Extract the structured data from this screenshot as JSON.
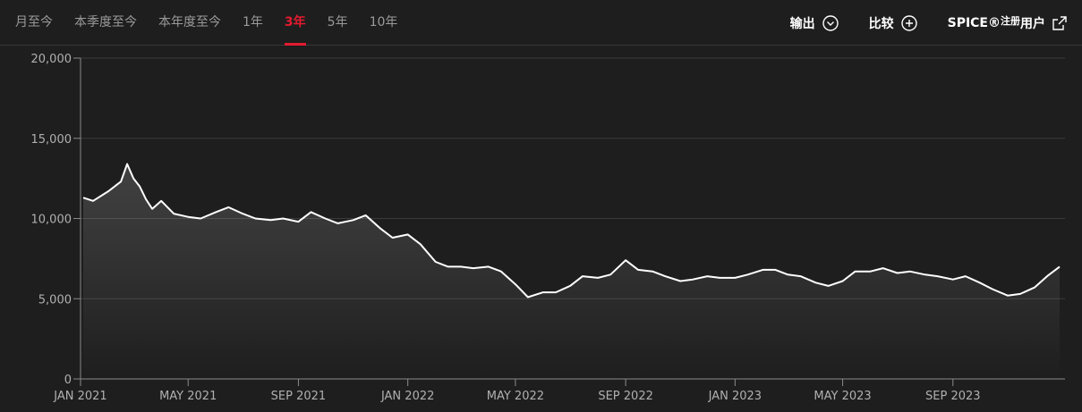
{
  "tabs": [
    {
      "label": "月至今",
      "active": false
    },
    {
      "label": "本季度至今",
      "active": false
    },
    {
      "label": "本年度至今",
      "active": false
    },
    {
      "label": "1年",
      "active": false
    },
    {
      "label": "3年",
      "active": true
    },
    {
      "label": "5年",
      "active": false
    },
    {
      "label": "10年",
      "active": false
    }
  ],
  "actions": {
    "export_label": "输出",
    "compare_label": "比较",
    "spice_label": "SPICE®",
    "spice_sup": "注册",
    "spice_suffix": "用户"
  },
  "colors": {
    "background": "#1e1e1e",
    "accent": "#e31b2f",
    "line": "#ffffff",
    "text_muted": "#9a9a9a"
  },
  "chart_data": {
    "type": "line",
    "title": "",
    "xlabel": "",
    "ylabel": "",
    "ylim": [
      0,
      20000
    ],
    "y_ticks": [
      "0",
      "5,000",
      "10,000",
      "15,000",
      "20,000"
    ],
    "x_ticks": [
      "JAN 2021",
      "MAY 2021",
      "SEP 2021",
      "JAN 2022",
      "MAY 2022",
      "SEP 2022",
      "JAN 2023",
      "MAY 2023",
      "SEP 2023"
    ],
    "grid": "horizontal",
    "series": [
      {
        "x": [
          "2021-01-04",
          "2021-01-15",
          "2021-02-01",
          "2021-02-15",
          "2021-02-22",
          "2021-03-01",
          "2021-03-08",
          "2021-03-15",
          "2021-03-22",
          "2021-04-01",
          "2021-04-15",
          "2021-05-01",
          "2021-05-15",
          "2021-06-01",
          "2021-06-15",
          "2021-07-01",
          "2021-07-15",
          "2021-08-01",
          "2021-08-15",
          "2021-09-01",
          "2021-09-15",
          "2021-10-01",
          "2021-10-15",
          "2021-11-01",
          "2021-11-15",
          "2021-12-01",
          "2021-12-15",
          "2022-01-01",
          "2022-01-15",
          "2022-02-01",
          "2022-02-15",
          "2022-03-01",
          "2022-03-15",
          "2022-04-01",
          "2022-04-15",
          "2022-05-01",
          "2022-05-15",
          "2022-06-01",
          "2022-06-15",
          "2022-07-01",
          "2022-07-15",
          "2022-08-01",
          "2022-08-15",
          "2022-09-01",
          "2022-09-15",
          "2022-10-01",
          "2022-10-15",
          "2022-11-01",
          "2022-11-15",
          "2022-12-01",
          "2022-12-15",
          "2023-01-01",
          "2023-01-15",
          "2023-02-01",
          "2023-02-15",
          "2023-03-01",
          "2023-03-15",
          "2023-04-01",
          "2023-04-15",
          "2023-05-01",
          "2023-05-15",
          "2023-06-01",
          "2023-06-15",
          "2023-07-01",
          "2023-07-15",
          "2023-08-01",
          "2023-08-15",
          "2023-09-01",
          "2023-09-15",
          "2023-10-01",
          "2023-10-15",
          "2023-11-01",
          "2023-11-15",
          "2023-12-01",
          "2023-12-15",
          "2023-12-29"
        ],
        "values": [
          11300,
          11100,
          11700,
          12300,
          13400,
          12500,
          12000,
          11200,
          10600,
          11100,
          10300,
          10100,
          10000,
          10400,
          10700,
          10300,
          10000,
          9900,
          10000,
          9800,
          10400,
          10000,
          9700,
          9900,
          10200,
          9400,
          8800,
          9000,
          8400,
          7300,
          7000,
          7000,
          6900,
          7000,
          6700,
          5900,
          5100,
          5400,
          5400,
          5800,
          6400,
          6300,
          6500,
          7400,
          6800,
          6700,
          6400,
          6100,
          6200,
          6400,
          6300,
          6300,
          6500,
          6800,
          6800,
          6500,
          6400,
          6000,
          5800,
          6100,
          6700,
          6700,
          6900,
          6600,
          6700,
          6500,
          6400,
          6200,
          6400,
          6000,
          5600,
          5200,
          5300,
          5700,
          6400,
          7000
        ]
      }
    ]
  }
}
